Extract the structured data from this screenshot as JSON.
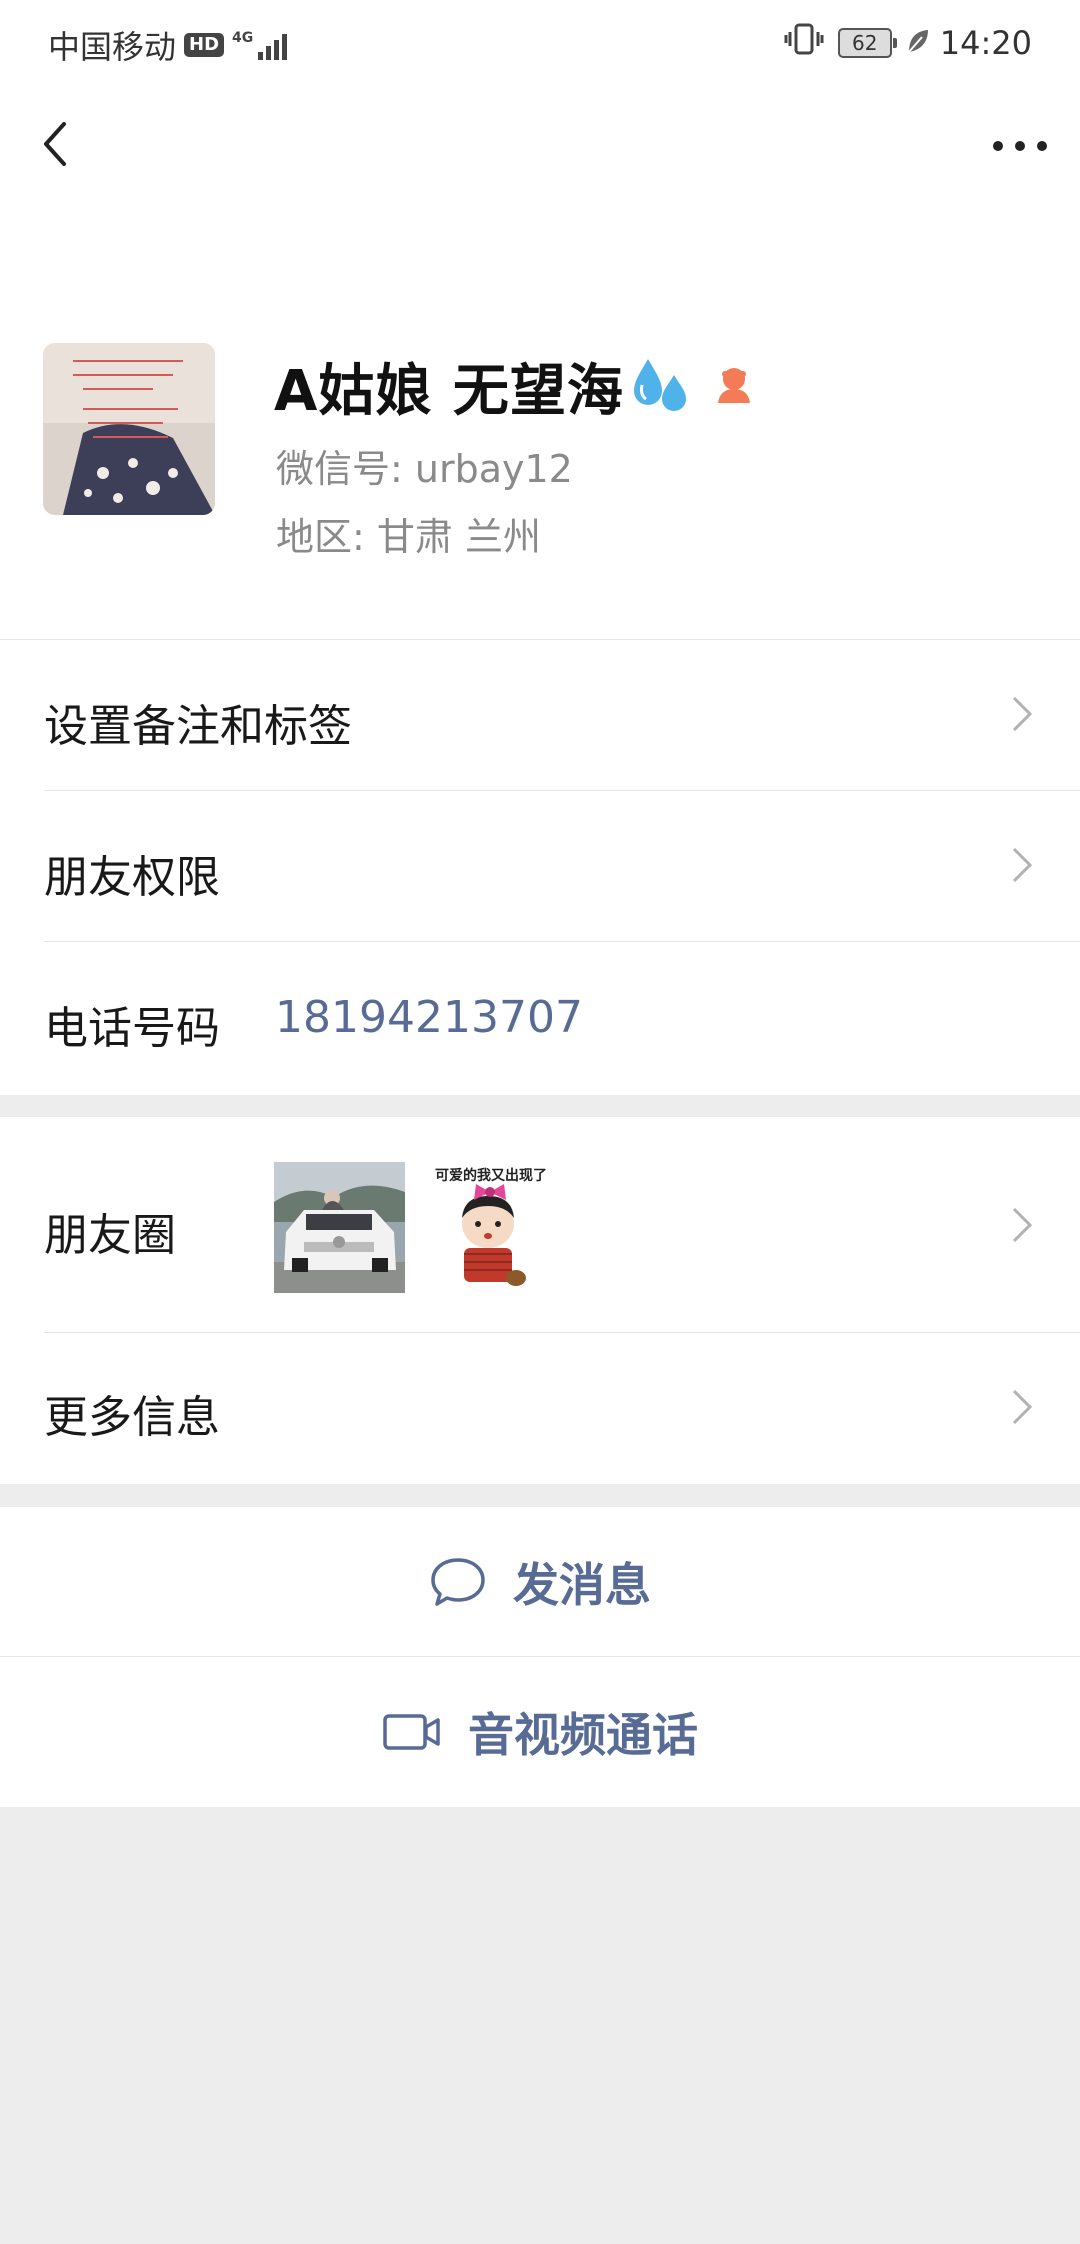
{
  "status_bar": {
    "carrier": "中国移动",
    "hd_badge": "HD",
    "network": "4G",
    "battery": "62",
    "time": "14:20"
  },
  "profile": {
    "name": "A姑娘 无望海",
    "wechat_id": "微信号: urbay12",
    "region": "地区: 甘肃 兰州",
    "gender_color": "#f37b56"
  },
  "list": {
    "remark_tags": "设置备注和标签",
    "friend_permissions": "朋友权限",
    "phone_label": "电话号码",
    "phone_value": "18194213707",
    "moments": "朋友圈",
    "moments_thumb2_caption": "可爱的我又出现了",
    "more_info": "更多信息"
  },
  "actions": {
    "send_message": "发消息",
    "video_call": "音视频通话"
  },
  "colors": {
    "link": "#576b95",
    "background": "#ededed"
  }
}
